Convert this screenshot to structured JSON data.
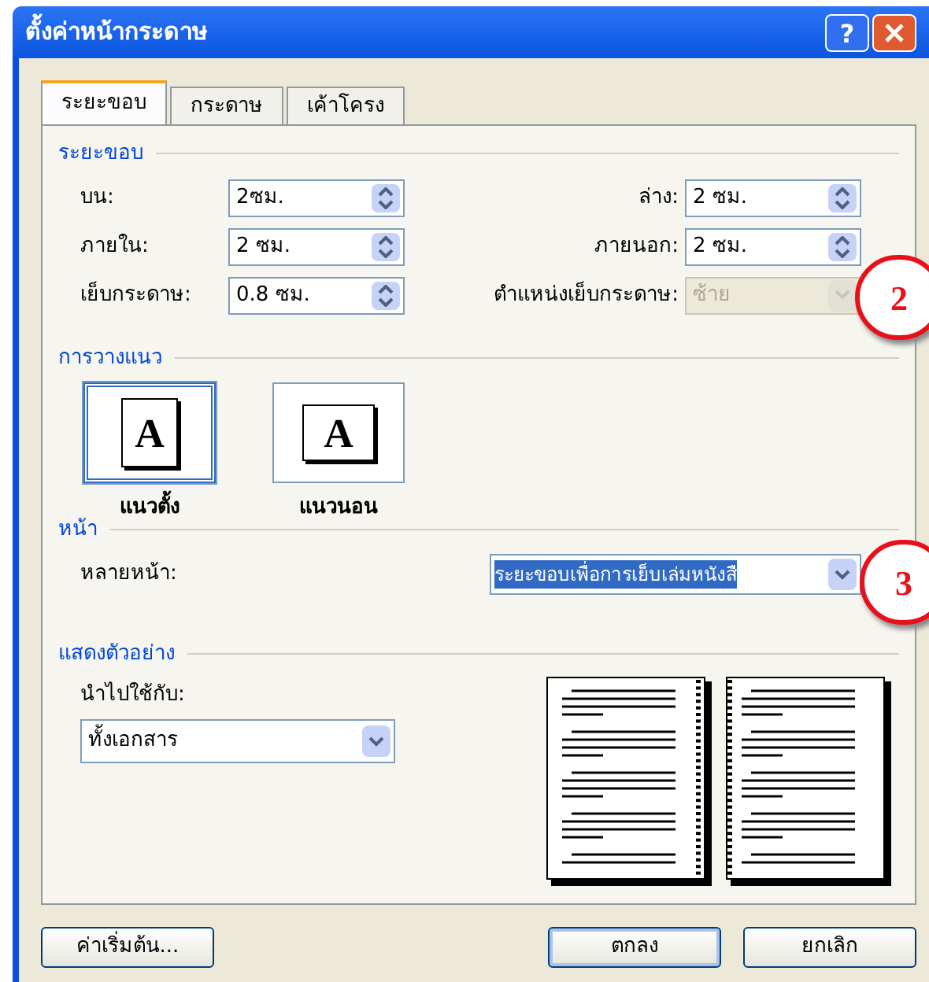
{
  "window": {
    "title": "ตั้งค่าหน้ากระดาษ",
    "help_button": "?"
  },
  "tabs": [
    {
      "label": "ระยะขอบ",
      "selected": true
    },
    {
      "label": "กระดาษ",
      "selected": false
    },
    {
      "label": "เค้าโครง",
      "selected": false
    }
  ],
  "margins": {
    "title": "ระยะขอบ",
    "left_fields": [
      {
        "label": "บน:",
        "value": "2ซม."
      },
      {
        "label": "ภายใน:",
        "value": "2 ซม."
      },
      {
        "label": "เย็บกระดาษ:",
        "value": "0.8 ซม."
      }
    ],
    "right_fields": [
      {
        "label": "ล่าง:",
        "value": "2 ซม."
      },
      {
        "label": "ภายนอก:",
        "value": "2 ซม."
      }
    ],
    "gutter_position": {
      "label": "ตำแหน่งเย็บกระดาษ:",
      "value": "ซ้าย",
      "disabled": true
    }
  },
  "orientation": {
    "title": "การวางแนว",
    "options": [
      {
        "label": "แนวตั้ง",
        "glyph": "A",
        "kind": "portrait",
        "selected": true
      },
      {
        "label": "แนวนอน",
        "glyph": "A",
        "kind": "landscape",
        "selected": false
      }
    ]
  },
  "pages": {
    "title": "หน้า",
    "label": "หลายหน้า:",
    "value": "ระยะขอบเพื่อการเย็บเล่มหนังสื"
  },
  "preview": {
    "title": "แสดงตัวอย่าง",
    "apply_label": "นำไปใช้กับ:",
    "apply_value": "ทั้งเอกสาร"
  },
  "buttons": [
    {
      "label": "ค่าเริ่มต้น...",
      "default": false
    },
    {
      "label": "ตกลง",
      "default": true
    },
    {
      "label": "ยกเลิก",
      "default": false
    }
  ],
  "callouts": [
    "2",
    "3"
  ]
}
